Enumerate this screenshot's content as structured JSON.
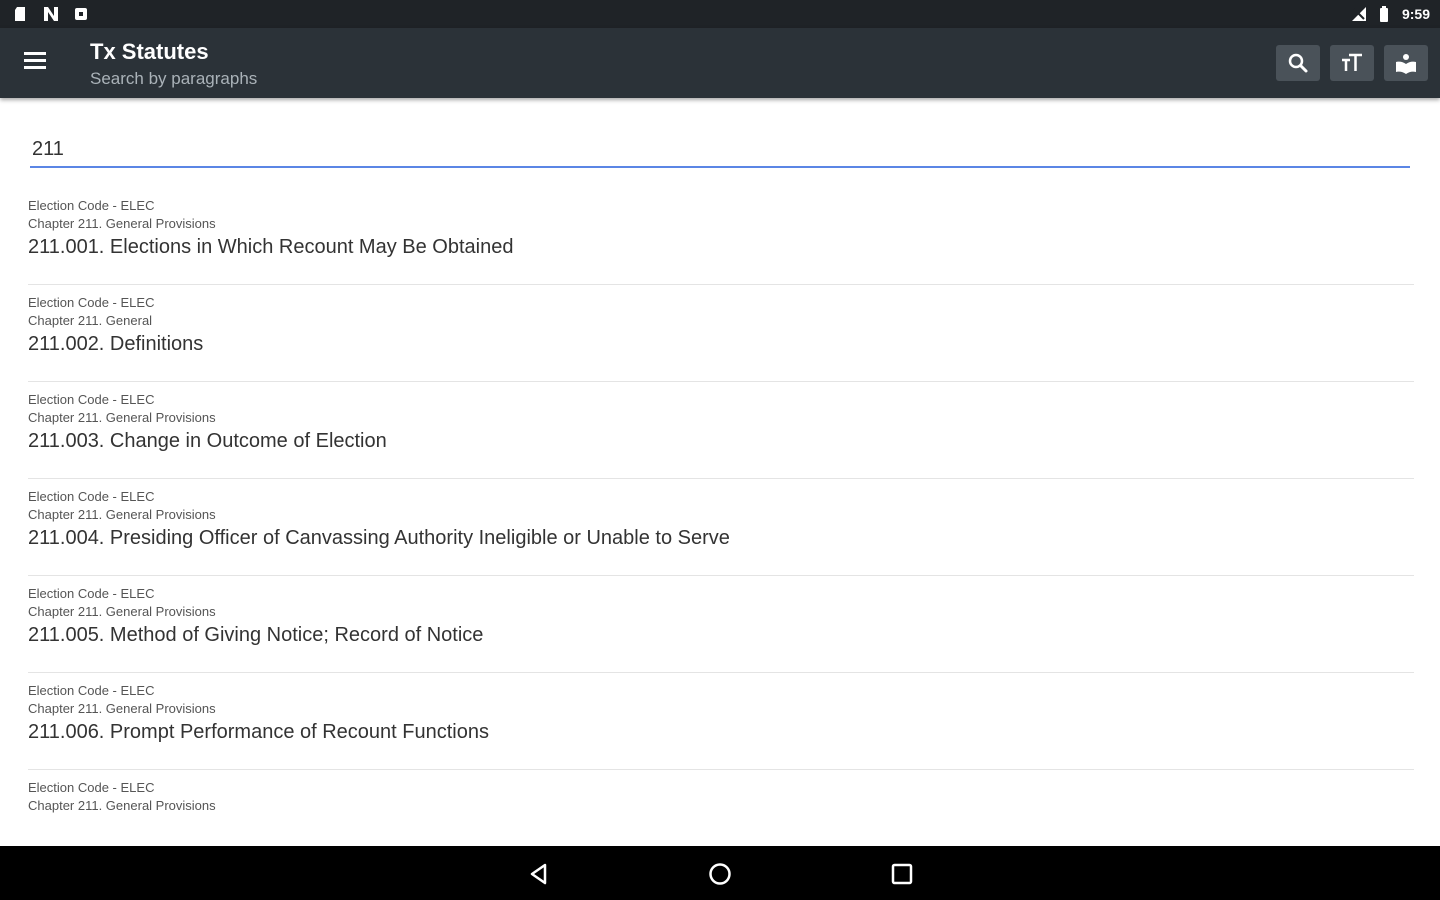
{
  "status_bar": {
    "time": "9:59",
    "left_icons": [
      "sd-card-icon",
      "n-icon",
      "screenshot-icon"
    ],
    "right_icons": [
      "signal-icon",
      "battery-icon"
    ]
  },
  "app_bar": {
    "title": "Tx Statutes",
    "subtitle": "Search by paragraphs",
    "actions": [
      "search-icon",
      "text-size-icon",
      "book-icon"
    ]
  },
  "search": {
    "value": "211"
  },
  "results": [
    {
      "code": "Election Code - ELEC",
      "chapter": "Chapter 211. General Provisions",
      "title": "211.001. Elections in Which Recount May Be Obtained"
    },
    {
      "code": "Election Code - ELEC",
      "chapter": "Chapter 211. General",
      "title": "211.002. Definitions"
    },
    {
      "code": "Election Code - ELEC",
      "chapter": "Chapter 211. General Provisions",
      "title": "211.003. Change in Outcome of Election"
    },
    {
      "code": "Election Code - ELEC",
      "chapter": "Chapter 211. General Provisions",
      "title": "211.004. Presiding Officer of Canvassing Authority Ineligible or Unable to Serve"
    },
    {
      "code": "Election Code - ELEC",
      "chapter": "Chapter 211. General Provisions",
      "title": "211.005. Method of Giving Notice;  Record of Notice"
    },
    {
      "code": "Election Code - ELEC",
      "chapter": "Chapter 211. General Provisions",
      "title": "211.006. Prompt Performance of Recount Functions"
    },
    {
      "code": "Election Code - ELEC",
      "chapter": "Chapter 211. General Provisions",
      "title": ""
    }
  ],
  "nav_bar": {
    "buttons": [
      "back-icon",
      "home-icon",
      "recents-icon"
    ]
  },
  "colors": {
    "status_bar": "#1f2327",
    "app_bar": "#2b3238",
    "action_button": "#4a5259",
    "search_underline": "#5b86e5",
    "nav_bar": "#000000"
  }
}
